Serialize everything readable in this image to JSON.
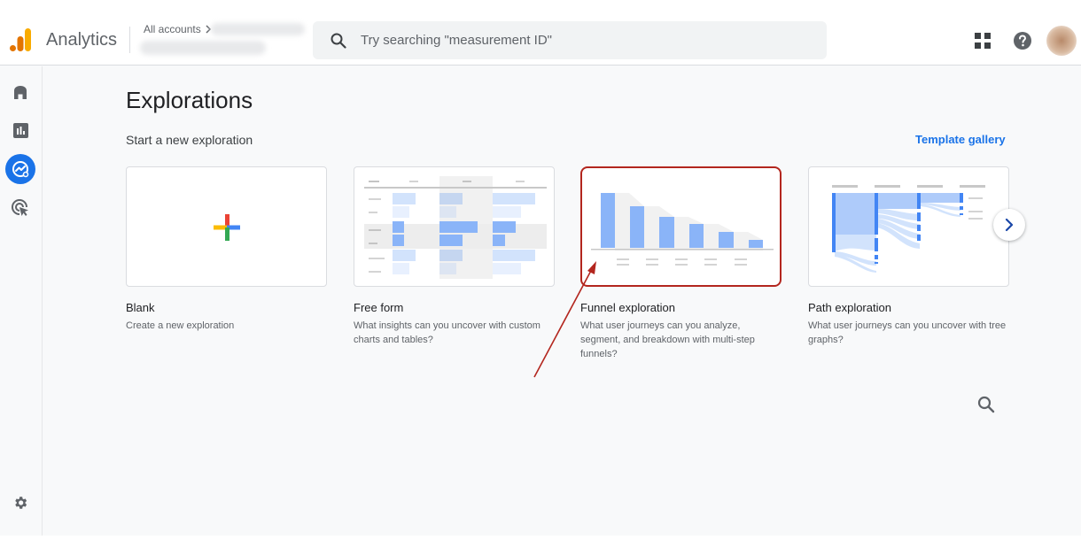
{
  "header": {
    "product_name": "Analytics",
    "account_breadcrumb": "All accounts",
    "search_placeholder": "Try searching \"measurement ID\""
  },
  "sidebar": {
    "items": [
      {
        "name": "home",
        "label": "Home"
      },
      {
        "name": "reports",
        "label": "Reports"
      },
      {
        "name": "explore",
        "label": "Explore",
        "active": true
      },
      {
        "name": "advertising",
        "label": "Advertising"
      }
    ],
    "admin_label": "Admin"
  },
  "main": {
    "title": "Explorations",
    "section_label": "Start a new exploration",
    "template_gallery_label": "Template gallery",
    "cards": [
      {
        "title": "Blank",
        "description": "Create a new exploration"
      },
      {
        "title": "Free form",
        "description": "What insights can you uncover with custom charts and tables?"
      },
      {
        "title": "Funnel exploration",
        "description": "What user journeys can you analyze, segment, and breakdown with multi-step funnels?",
        "highlighted": true
      },
      {
        "title": "Path exploration",
        "description": "What user journeys can you uncover with tree graphs?"
      }
    ]
  },
  "colors": {
    "accent": "#1a73e8",
    "highlight": "#b3261e",
    "logo_dark": "#e37400",
    "logo_light": "#f9ab00"
  }
}
